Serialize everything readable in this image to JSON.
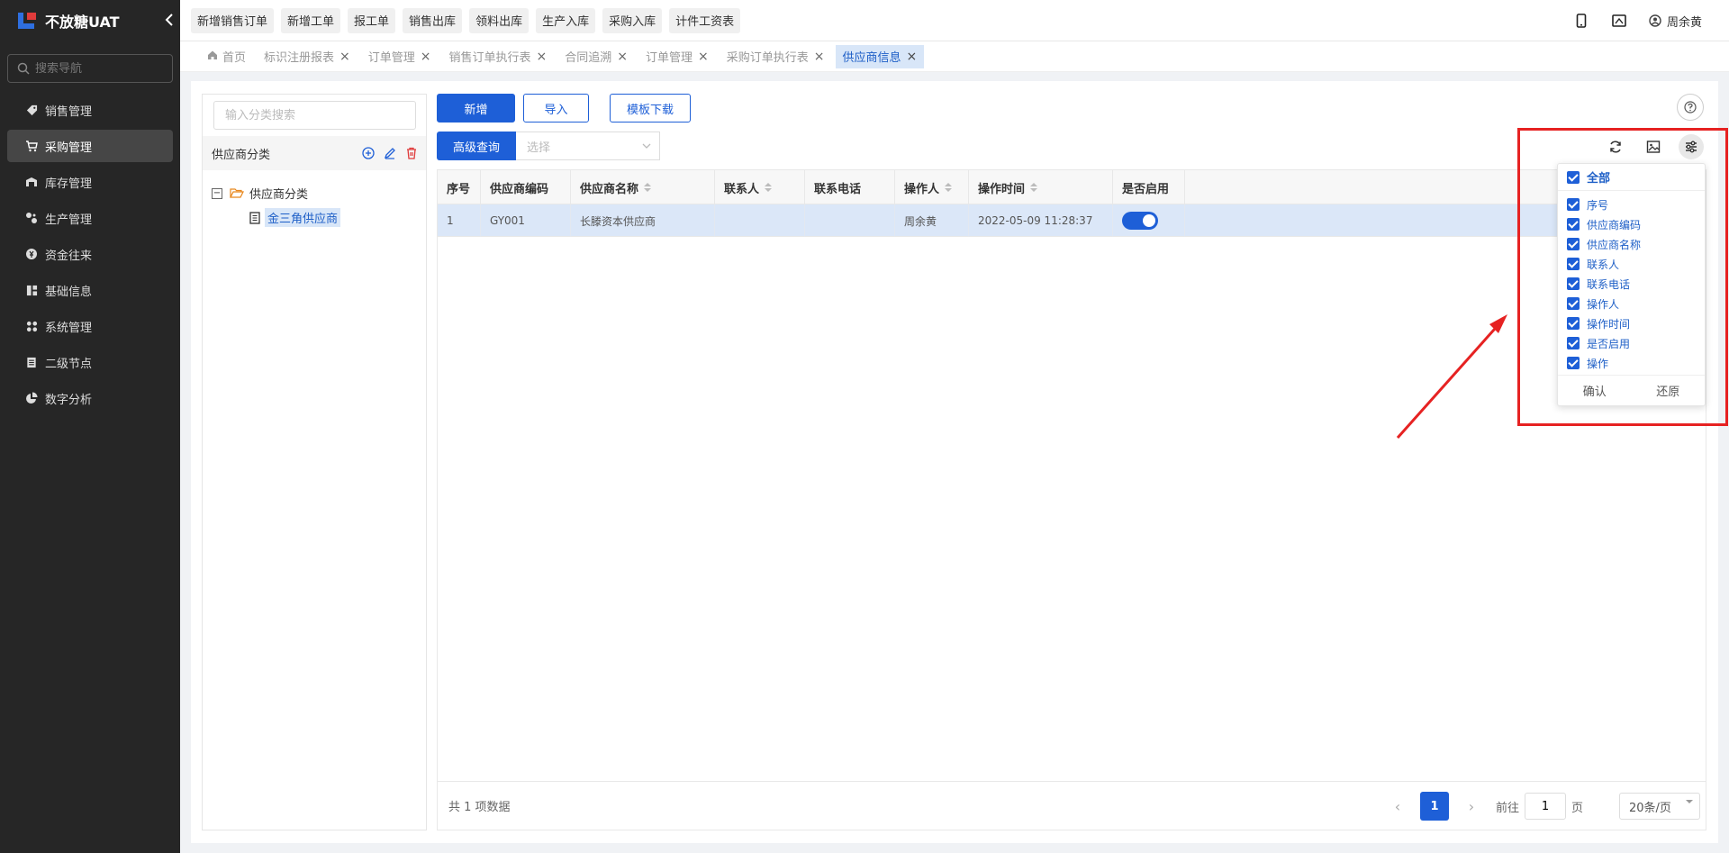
{
  "brand": {
    "title": "不放糖UAT",
    "collapse_icon": "chevron-left-icon"
  },
  "sidebar": {
    "search_placeholder": "搜索导航",
    "items": [
      {
        "label": "销售管理",
        "icon": "tag-icon",
        "active": false
      },
      {
        "label": "采购管理",
        "icon": "cart-icon",
        "active": true
      },
      {
        "label": "库存管理",
        "icon": "warehouse-icon",
        "active": false
      },
      {
        "label": "生产管理",
        "icon": "production-icon",
        "active": false
      },
      {
        "label": "资金往来",
        "icon": "money-icon",
        "active": false
      },
      {
        "label": "基础信息",
        "icon": "base-info-icon",
        "active": false
      },
      {
        "label": "系统管理",
        "icon": "system-icon",
        "active": false
      },
      {
        "label": "二级节点",
        "icon": "node-icon",
        "active": false
      },
      {
        "label": "数字分析",
        "icon": "pie-chart-icon",
        "active": false
      }
    ]
  },
  "topbar": {
    "quick_buttons": [
      "新增销售订单",
      "新增工单",
      "报工单",
      "销售出库",
      "领料出库",
      "生产入库",
      "采购入库",
      "计件工资表"
    ],
    "user_name": "周余黄"
  },
  "tabs": [
    {
      "label": "首页",
      "closable": false,
      "active": false
    },
    {
      "label": "标识注册报表",
      "closable": true,
      "active": false
    },
    {
      "label": "订单管理",
      "closable": true,
      "active": false
    },
    {
      "label": "销售订单执行表",
      "closable": true,
      "active": false
    },
    {
      "label": "合同追溯",
      "closable": true,
      "active": false
    },
    {
      "label": "订单管理",
      "closable": true,
      "active": false
    },
    {
      "label": "采购订单执行表",
      "closable": true,
      "active": false
    },
    {
      "label": "供应商信息",
      "closable": true,
      "active": true
    }
  ],
  "tab_close_glyph": "×",
  "tree": {
    "search_placeholder": "输入分类搜索",
    "title": "供应商分类",
    "root_toggle": "−",
    "root": "供应商分类",
    "child": "金三角供应商"
  },
  "toolbar": {
    "add": "新增",
    "import": "导入",
    "template_download": "模板下载",
    "advanced_query": "高级查询",
    "select_placeholder": "选择"
  },
  "table": {
    "columns": [
      "序号",
      "供应商编码",
      "供应商名称",
      "联系人",
      "联系电话",
      "操作人",
      "操作时间",
      "是否启用"
    ],
    "rows": [
      {
        "index": "1",
        "code": "GY001",
        "name": "长滕资本供应商",
        "contact": "",
        "phone": "",
        "operator": "周余黄",
        "time": "2022-05-09 11:28:37",
        "enabled": true
      }
    ]
  },
  "footer": {
    "total": "共 1 项数据",
    "current_page": "1",
    "goto_label": "前往",
    "goto_value": "1",
    "page_unit": "页",
    "page_size": "20条/页"
  },
  "column_popup": {
    "all_label": "全部",
    "items": [
      "序号",
      "供应商编码",
      "供应商名称",
      "联系人",
      "联系电话",
      "操作人",
      "操作时间",
      "是否启用",
      "操作"
    ],
    "confirm": "确认",
    "reset": "还原"
  },
  "colors": {
    "accent": "#1e5fd7",
    "highlight": "#e62222",
    "sidebar_bg": "#262626"
  }
}
